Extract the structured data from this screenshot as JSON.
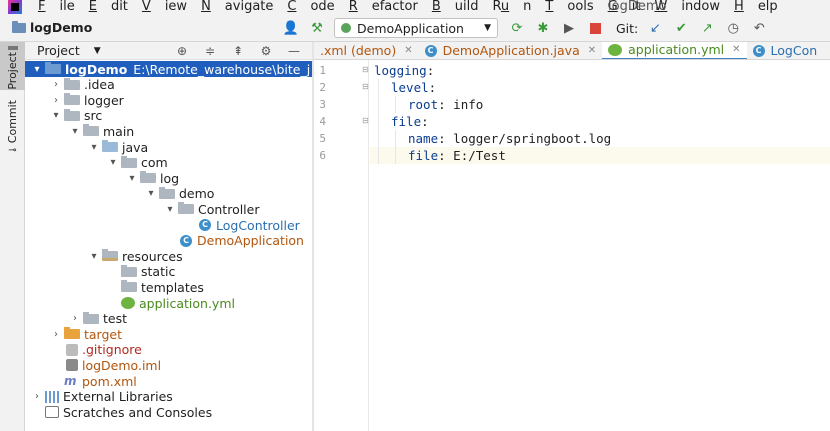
{
  "menubar": {
    "items": [
      {
        "label": "File",
        "mnemonic": "F"
      },
      {
        "label": "Edit",
        "mnemonic": "E"
      },
      {
        "label": "View",
        "mnemonic": "V"
      },
      {
        "label": "Navigate",
        "mnemonic": "N"
      },
      {
        "label": "Code",
        "mnemonic": "C"
      },
      {
        "label": "Refactor",
        "mnemonic": "R"
      },
      {
        "label": "Build",
        "mnemonic": "B"
      },
      {
        "label": "Run",
        "mnemonic": "u"
      },
      {
        "label": "Tools",
        "mnemonic": "T"
      },
      {
        "label": "Git",
        "mnemonic": "G"
      },
      {
        "label": "Window",
        "mnemonic": "W"
      },
      {
        "label": "Help",
        "mnemonic": "H"
      }
    ],
    "window_title": "logDemo"
  },
  "toolbar": {
    "breadcrumb": "logDemo",
    "run_config": "DemoApplication",
    "git_label": "Git:",
    "colors": {
      "run": "#5aa45a",
      "stop": "#d9453a",
      "git_check": "#3a9a3a",
      "git_update": "#2a6fb0"
    }
  },
  "left_strip": {
    "project_label": "Project",
    "commit_label": "Commit"
  },
  "project_panel": {
    "title": "Project",
    "tree": [
      {
        "label": "logDemo",
        "extra": "E:\\Remote_warehouse\\bite_j",
        "indent": 0,
        "arrow": "▾",
        "icon": "folder blue",
        "color": "",
        "selected": true,
        "bold": true
      },
      {
        "label": ".idea",
        "indent": 1,
        "arrow": "›",
        "icon": "folder",
        "color": ""
      },
      {
        "label": "logger",
        "indent": 1,
        "arrow": "›",
        "icon": "folder",
        "color": ""
      },
      {
        "label": "src",
        "indent": 1,
        "arrow": "▾",
        "icon": "folder",
        "color": ""
      },
      {
        "label": "main",
        "indent": 2,
        "arrow": "▾",
        "icon": "folder",
        "color": ""
      },
      {
        "label": "java",
        "indent": 3,
        "arrow": "▾",
        "icon": "folder light",
        "color": ""
      },
      {
        "label": "com",
        "indent": 4,
        "arrow": "▾",
        "icon": "folder",
        "color": ""
      },
      {
        "label": "log",
        "indent": 5,
        "arrow": "▾",
        "icon": "folder",
        "color": ""
      },
      {
        "label": "demo",
        "indent": 6,
        "arrow": "▾",
        "icon": "folder",
        "color": ""
      },
      {
        "label": "Controller",
        "indent": 7,
        "arrow": "▾",
        "icon": "folder",
        "color": ""
      },
      {
        "label": "LogController",
        "indent": 8,
        "arrow": "",
        "icon": "cls",
        "color": "c-blue"
      },
      {
        "label": "DemoApplication",
        "indent": 7,
        "arrow": "",
        "icon": "cls",
        "color": "c-orange"
      },
      {
        "label": "resources",
        "indent": 3,
        "arrow": "▾",
        "icon": "folder res",
        "color": ""
      },
      {
        "label": "static",
        "indent": 4,
        "arrow": "",
        "icon": "folder",
        "color": ""
      },
      {
        "label": "templates",
        "indent": 4,
        "arrow": "",
        "icon": "folder",
        "color": ""
      },
      {
        "label": "application.yml",
        "indent": 4,
        "arrow": "",
        "icon": "spring",
        "color": "c-green"
      },
      {
        "label": "test",
        "indent": 2,
        "arrow": "›",
        "icon": "folder",
        "color": ""
      },
      {
        "label": "target",
        "indent": 1,
        "arrow": "›",
        "icon": "folder orange",
        "color": "c-orange"
      },
      {
        "label": ".gitignore",
        "indent": 1,
        "arrow": "",
        "icon": "git",
        "color": "c-red"
      },
      {
        "label": "logDemo.iml",
        "indent": 1,
        "arrow": "",
        "icon": "iml",
        "color": "c-orange"
      },
      {
        "label": "pom.xml",
        "indent": 1,
        "arrow": "",
        "icon": "maven",
        "color": "c-orange"
      },
      {
        "label": "External Libraries",
        "indent": 0,
        "arrow": "›",
        "icon": "lib",
        "color": ""
      },
      {
        "label": "Scratches and Consoles",
        "indent": 0,
        "arrow": "",
        "icon": "scratch",
        "color": ""
      }
    ]
  },
  "editor": {
    "tabs": [
      {
        "label": ".xml (demo)",
        "icon": "none",
        "color": "c-orange",
        "active": false
      },
      {
        "label": "DemoApplication.java",
        "icon": "cls",
        "color": "c-orange",
        "active": false
      },
      {
        "label": "application.yml",
        "icon": "spring",
        "color": "c-green",
        "active": true
      },
      {
        "label": "LogCon",
        "icon": "cls",
        "color": "c-blue",
        "active": false
      }
    ],
    "lines": [
      {
        "num": "1",
        "indent": 0,
        "key": "logging",
        "value": ""
      },
      {
        "num": "2",
        "indent": 1,
        "key": "level",
        "value": ""
      },
      {
        "num": "3",
        "indent": 2,
        "key": "root",
        "value": "info"
      },
      {
        "num": "4",
        "indent": 1,
        "key": "file",
        "value": ""
      },
      {
        "num": "5",
        "indent": 2,
        "key": "name",
        "value": "logger/springboot.log"
      },
      {
        "num": "6",
        "indent": 2,
        "key": "file",
        "value": "E:/Test",
        "current": true
      }
    ]
  }
}
